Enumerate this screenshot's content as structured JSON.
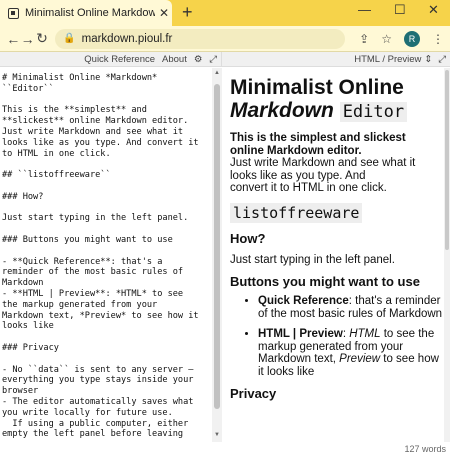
{
  "browser": {
    "tab_title": "Minimalist Online Markdown Edi",
    "tab_close": "✕",
    "new_tab": "+",
    "url": "markdown.pioul.fr",
    "minimize": "—",
    "maximize": "☐",
    "close": "✕",
    "profile_initial": "R"
  },
  "toolbar": {
    "quick_reference": "Quick Reference",
    "about": "About",
    "mode": "HTML / Preview"
  },
  "editor": {
    "lines": [
      "# Minimalist Online *Markdown*",
      "``Editor``",
      "",
      "This is the **simplest** and",
      "**slickest** online Markdown editor.",
      "Just write Markdown and see what it",
      "looks like as you type. And convert it",
      "to HTML in one click.",
      "",
      "## ``listoffreeware``",
      "",
      "### How?",
      "",
      "Just start typing in the left panel.",
      "",
      "### Buttons you might want to use",
      "",
      "- **Quick Reference**: that's a",
      "reminder of the most basic rules of",
      "Markdown",
      "- **HTML | Preview**: *HTML* to see",
      "the markup generated from your",
      "Markdown text, *Preview* to see how it",
      "looks like",
      "",
      "### Privacy",
      "",
      "- No ``data`` is sent to any server –",
      "everything you type stays inside your",
      "browser",
      "- The editor automatically saves what",
      "you write locally for future use.",
      "  If using a public computer, either",
      "empty the left panel before leaving"
    ]
  },
  "preview": {
    "h1_line1": "Minimalist Online",
    "h1_italic": "Markdown",
    "h1_code": "Editor",
    "intro_simplest": "This is the simplest and slickest",
    "intro_line2": "online Markdown editor.",
    "intro_line3": "Just write Markdown and see what it",
    "intro_line4": "looks like as you type. And",
    "intro_line5": "convert it to HTML in one click.",
    "h2_code": "listoffreeware",
    "h3_how": "How?",
    "how_text": "Just start typing in the left panel.",
    "h3_buttons": "Buttons you might want to use",
    "li1_bold": "Quick Reference",
    "li1_text": ": that's a reminder of the most basic rules of Markdown",
    "li2_bold": "HTML | Preview",
    "li2_colon": ": ",
    "li2_html": "HTML",
    "li2_mid": " to see the markup generated from your Markdown text, ",
    "li2_preview": "Preview",
    "li2_end": " to see how it looks like",
    "h3_privacy": "Privacy"
  },
  "footer": {
    "word_count": "127 words"
  }
}
